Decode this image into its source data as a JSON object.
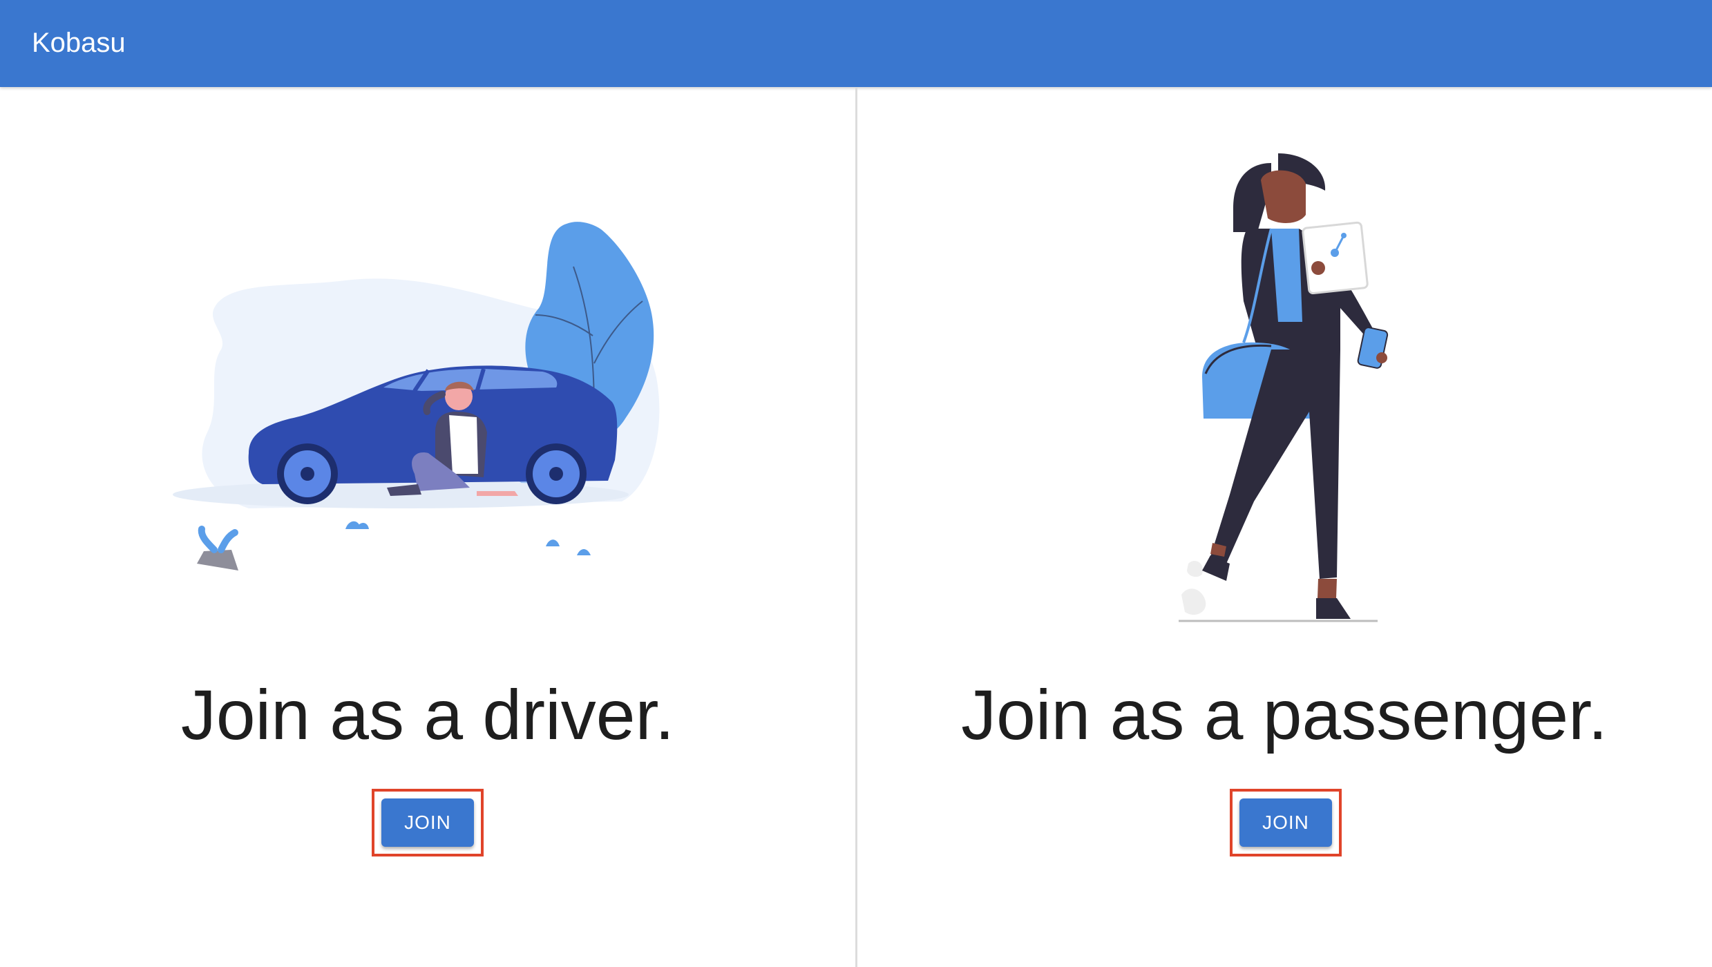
{
  "appbar": {
    "title": "Kobasu"
  },
  "driver": {
    "headline": "Join as a driver.",
    "join_label": "JOIN",
    "illustration": "driver-car-illustration"
  },
  "passenger": {
    "headline": "Join as a passenger.",
    "join_label": "JOIN",
    "illustration": "passenger-walking-illustration"
  },
  "colors": {
    "primary": "#3a77cf",
    "highlight_border": "#e0442a",
    "illustration_blue": "#5b9ee9",
    "car_blue": "#2f4cb0",
    "dark_figure": "#2d2b3d"
  }
}
